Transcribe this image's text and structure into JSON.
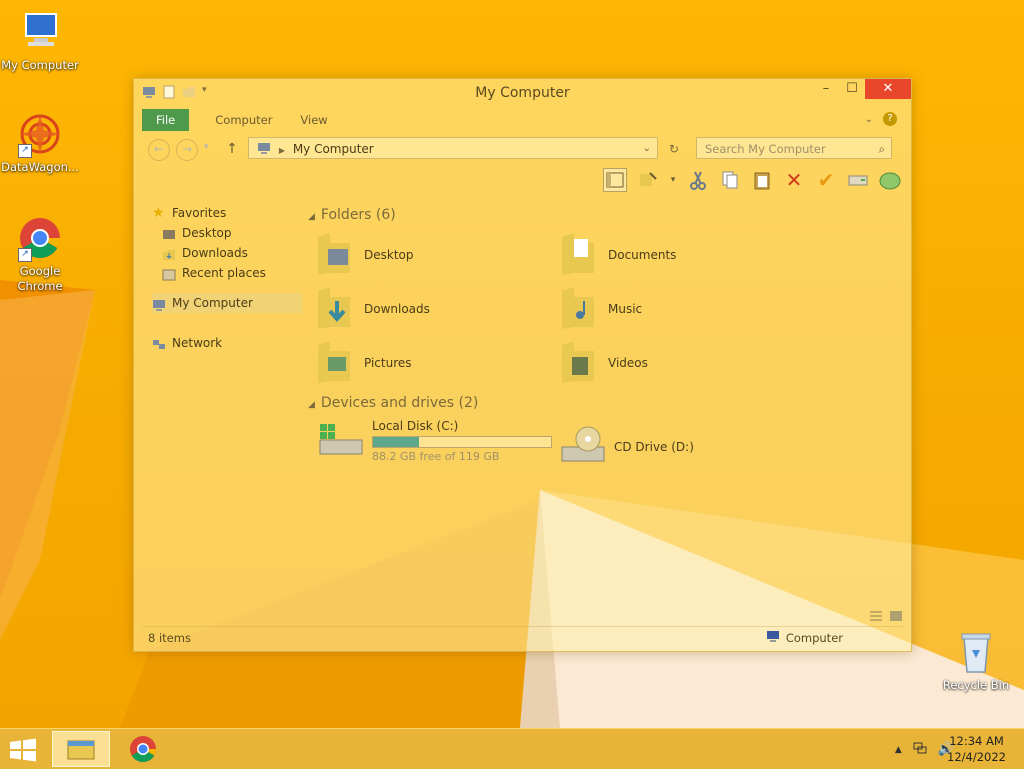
{
  "desktop": {
    "icons": [
      {
        "label": "My Computer",
        "icon": "computer-icon"
      },
      {
        "label": "DataWagon...",
        "icon": "datawagon-icon"
      },
      {
        "label": "Google Chrome",
        "icon": "chrome-icon"
      },
      {
        "label": "Recycle Bin",
        "icon": "recycle-bin-icon"
      }
    ]
  },
  "window": {
    "title": "My Computer",
    "controls": {
      "minimize": "–",
      "maximize": "☐",
      "close": "✕"
    },
    "ribbon_tabs": [
      "File",
      "Computer",
      "View"
    ],
    "address": {
      "back": "←",
      "forward": "→",
      "up": "↑",
      "path": "My Computer"
    },
    "search": {
      "placeholder": "Search My Computer"
    },
    "nav": {
      "favorites_label": "Favorites",
      "favorites": [
        "Desktop",
        "Downloads",
        "Recent places"
      ],
      "my_computer": "My Computer",
      "network": "Network"
    },
    "folders_header": "Folders (6)",
    "folders": [
      "Desktop",
      "Documents",
      "Downloads",
      "Music",
      "Pictures",
      "Videos"
    ],
    "devices_header": "Devices and drives (2)",
    "drives": {
      "c_name": "Local Disk (C:)",
      "c_free": "88.2 GB free of 119 GB",
      "c_used_fraction": 0.26,
      "d_name": "CD Drive (D:)"
    },
    "status": {
      "items": "8 items",
      "location": "Computer"
    }
  },
  "taskbar": {
    "time": "12:34 AM",
    "date": "12/4/2022"
  }
}
